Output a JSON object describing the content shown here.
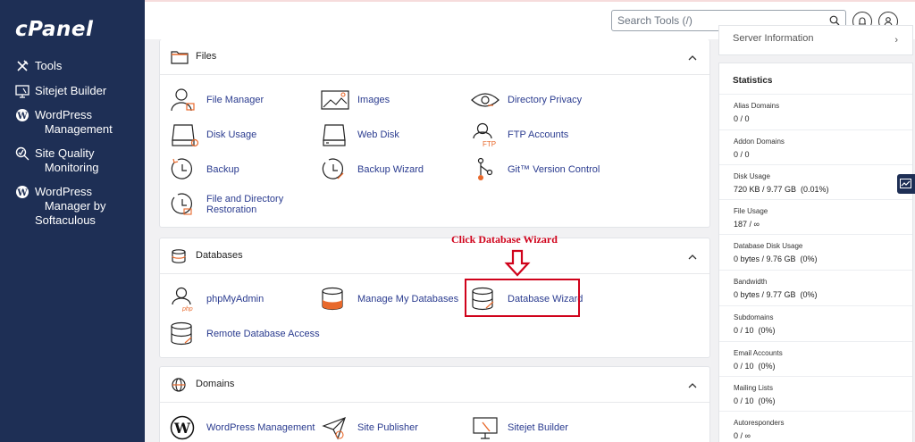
{
  "sidebar": {
    "logo": "cPanel",
    "items": [
      {
        "label": "Tools",
        "icon": "tools-icon"
      },
      {
        "label": "Sitejet Builder",
        "icon": "sitejet-icon"
      },
      {
        "label": "WordPress\n   Management",
        "icon": "wordpress-icon"
      },
      {
        "label": "Site Quality\n   Monitoring",
        "icon": "site-quality-icon"
      },
      {
        "label": "WordPress\n   Manager by\nSoftaculous",
        "icon": "wordpress-icon"
      }
    ]
  },
  "topbar": {
    "search_placeholder": "Search Tools (/)",
    "notifications_icon": "bell-icon",
    "user_icon": "user-icon"
  },
  "files": {
    "title": "Files",
    "tools": [
      "File Manager",
      "Images",
      "Directory Privacy",
      "Disk Usage",
      "Web Disk",
      "FTP Accounts",
      "Backup",
      "Backup Wizard",
      "Git™ Version Control",
      "File and Directory\nRestoration"
    ]
  },
  "annotation": {
    "text": "Click Database Wizard"
  },
  "databases": {
    "title": "Databases",
    "tools": [
      "phpMyAdmin",
      "Manage My Databases",
      "Database Wizard",
      "Remote Database Access"
    ]
  },
  "domains": {
    "title": "Domains",
    "tools": [
      "WordPress Management",
      "Site Publisher",
      "Sitejet Builder"
    ]
  },
  "server_info": {
    "label": "Server Information",
    "arrow": "›"
  },
  "statistics": {
    "title": "Statistics",
    "rows": [
      {
        "label": "Alias Domains",
        "value": "0 / 0"
      },
      {
        "label": "Addon Domains",
        "value": "0 / 0"
      },
      {
        "label": "Disk Usage",
        "value": "720 KB / 9.77 GB  (0.01%)"
      },
      {
        "label": "File Usage",
        "value": "187 / ∞"
      },
      {
        "label": "Database Disk Usage",
        "value": "0 bytes / 9.76 GB  (0%)"
      },
      {
        "label": "Bandwidth",
        "value": "0 bytes / 9.77 GB  (0%)"
      },
      {
        "label": "Subdomains",
        "value": "0 / 10  (0%)"
      },
      {
        "label": "Email Accounts",
        "value": "0 / 10  (0%)"
      },
      {
        "label": "Mailing Lists",
        "value": "0 / 10  (0%)"
      },
      {
        "label": "Autoresponders",
        "value": "0 / ∞"
      }
    ]
  },
  "colors": {
    "sidebar_bg": "#1e2f55",
    "link": "#2a3b8f",
    "annotation_red": "#d0021b",
    "accent_orange": "#e8692c"
  }
}
